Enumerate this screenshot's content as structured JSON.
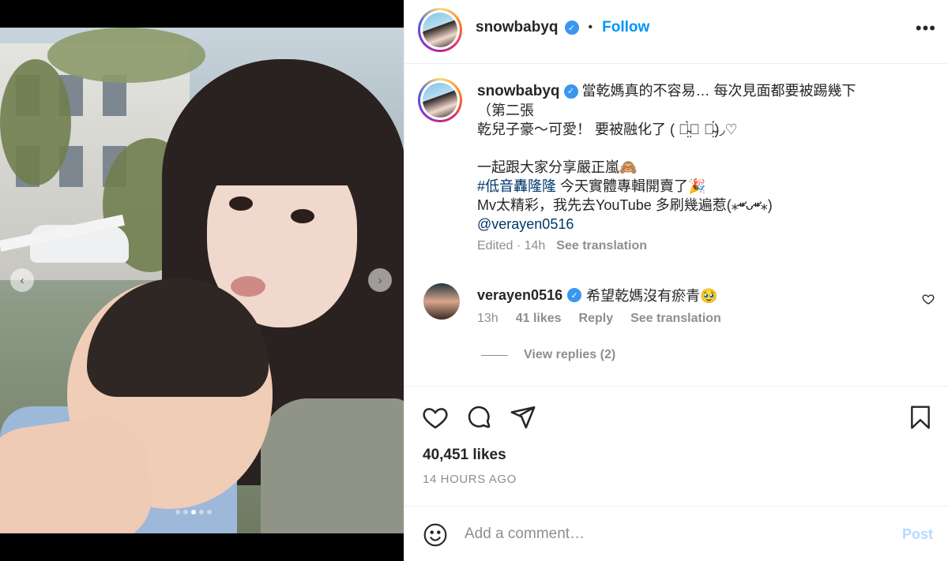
{
  "post": {
    "username": "snowbabyq",
    "follow_label": "Follow",
    "dot": "•",
    "more_label": "•••"
  },
  "media": {
    "prev_label": "‹",
    "next_label": "›",
    "slide_count": 5,
    "active_slide": 3
  },
  "caption": {
    "username": "snowbabyq",
    "line1": "當乾媽真的不容易… 每次見面都要被踢幾下",
    "line2": "（第二張",
    "line3": "乾兒子豪～可愛！ 要被融化了 ( ఠ̴̤̀⌣ ఠ̴̤́)◞♡",
    "line4": "一起跟大家分享嚴正嵐🙈",
    "hashtag": "#低音轟隆隆",
    "line5_rest": " 今天實體專輯開賣了🎉",
    "line6": "Mv太精彩，我先去YouTube 多刷幾遍惹(⁎⁍̴̛ᴗ⁍̴̛⁎)",
    "mention": "@verayen0516",
    "edited": "Edited · 14h",
    "see_translation": "See translation"
  },
  "comment": {
    "username": "verayen0516",
    "text": "希望乾媽沒有瘀青🥹",
    "time": "13h",
    "likes": "41 likes",
    "reply": "Reply",
    "see_translation": "See translation",
    "view_replies": "View replies (2)"
  },
  "actions": {
    "likes": "40,451 likes",
    "time_ago": "14 HOURS AGO"
  },
  "add_comment": {
    "placeholder": "Add a comment…",
    "post_label": "Post"
  },
  "icons": {
    "verified": "verified-badge-icon",
    "like": "heart-icon",
    "comment": "comment-bubble-icon",
    "share": "paper-plane-icon",
    "save": "bookmark-icon",
    "emoji": "emoji-face-icon"
  },
  "colors": {
    "accent": "#0095f6",
    "verified": "#3897f0",
    "link": "#00376b",
    "muted": "#8e8e8e",
    "post_disabled": "#b3dbff"
  }
}
